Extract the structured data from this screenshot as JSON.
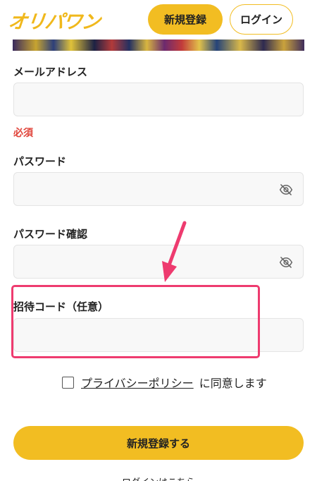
{
  "header": {
    "logo_text": "オリパワン",
    "register_label": "新規登録",
    "login_label": "ログイン"
  },
  "form": {
    "email_label": "メールアドレス",
    "email_value": "",
    "required_text": "必須",
    "password_label": "パスワード",
    "password_value": "",
    "password_confirm_label": "パスワード確認",
    "password_confirm_value": "",
    "invite_label": "招待コード（任意）",
    "invite_value": "",
    "policy_link": "プライバシーポリシー",
    "agree_suffix": "に同意します",
    "agree_checked": false,
    "submit_label": "新規登録する",
    "login_link": "ログインはこちら"
  },
  "annotation": {
    "highlight_color": "#ee3b6f"
  },
  "colors": {
    "accent": "#f2bd22",
    "error": "#e0443a"
  },
  "icons": {
    "password_toggle": "eye-slash-icon"
  }
}
